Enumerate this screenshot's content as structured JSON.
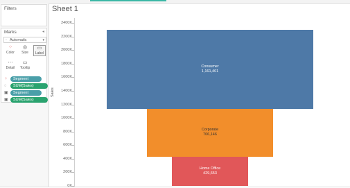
{
  "sheet": {
    "title": "Sheet 1"
  },
  "filters": {
    "title": "Filters"
  },
  "marks": {
    "title": "Marks",
    "type_dropdown": "Automatic",
    "buttons": [
      {
        "label": "Color",
        "icon": "color-icon"
      },
      {
        "label": "Size",
        "icon": "size-icon"
      },
      {
        "label": "Label",
        "icon": "label-icon"
      },
      {
        "label": "Detail",
        "icon": "detail-icon"
      },
      {
        "label": "Tooltip",
        "icon": "tooltip-icon"
      }
    ],
    "pills": [
      {
        "label": "Segment",
        "kind": "dimension",
        "icon": "color-icon"
      },
      {
        "label": "SUM(Sales)",
        "kind": "measure",
        "icon": "tooltip-icon"
      },
      {
        "label": "Segment",
        "kind": "dimension",
        "icon": "label-icon"
      },
      {
        "label": "SUM(Sales)",
        "kind": "measure",
        "icon": "label-icon"
      }
    ]
  },
  "colors": {
    "Consumer": "#4e79a7",
    "Corporate": "#f28e2b",
    "Home Office": "#e15759",
    "dimension_pill": "#4a9fa9",
    "measure_pill": "#2aa36f"
  },
  "chart_data": {
    "type": "bar",
    "orientation": "funnel",
    "ylabel": "Sales",
    "yticks": [
      "2400K",
      "2200K",
      "2000K",
      "1800K",
      "1600K",
      "1400K",
      "1200K",
      "1000K",
      "800K",
      "600K",
      "400K",
      "200K",
      "0K"
    ],
    "ylim": [
      0,
      2400000
    ],
    "categories": [
      "Consumer",
      "Corporate",
      "Home Office"
    ],
    "values": [
      1161401,
      706146,
      429653
    ],
    "value_labels": [
      "1,161,401",
      "706,146",
      "429,653"
    ]
  }
}
